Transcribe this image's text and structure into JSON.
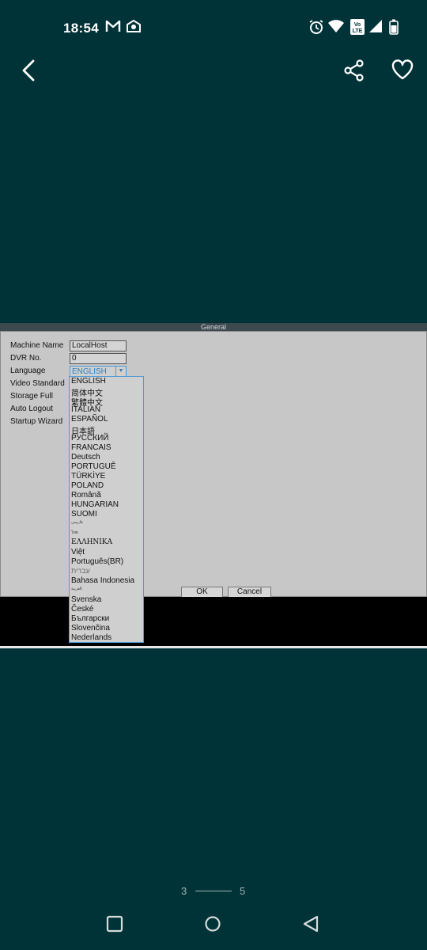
{
  "status_bar": {
    "time": "18:54",
    "icons": [
      "gmail-icon",
      "message-icon",
      "alarm-icon",
      "wifi-icon",
      "volte-icon",
      "signal-icon",
      "battery-icon"
    ],
    "volte_label": "Vo LTE"
  },
  "top_bar": {
    "back_icon": "back-arrow-icon",
    "share_icon": "share-icon",
    "favorite_icon": "heart-icon"
  },
  "dvr": {
    "title": "General",
    "labels": {
      "machine_name": "Machine Name",
      "dvr_no": "DVR No.",
      "language": "Language",
      "video_standard": "Video Standard",
      "storage_full": "Storage Full",
      "auto_logout": "Auto Logout",
      "startup_wizard": "Startup Wizard"
    },
    "values": {
      "machine_name": "LocalHost",
      "dvr_no": "0",
      "language": "ENGLISH"
    },
    "language_options": [
      "ENGLISH",
      "简体中文",
      "繁體中文",
      "ITALIAN",
      "ESPAÑOL",
      "日本語",
      "РУССКИЙ",
      "FRANCAIS",
      "Deutsch",
      "PORTUGUÊ",
      "TÜRKİYE",
      "POLAND",
      "Română",
      "HUNGARIAN",
      "SUOMI",
      "فارسی",
      "ไทย",
      "ΕΛΛΗΝΙΚΑ",
      "Việt",
      "Português(BR)",
      "עברית",
      "Bahasa Indonesia",
      "العربية",
      "Svenska",
      "České",
      "Български",
      "Slovenčina",
      "Nederlands"
    ],
    "ok_label": "OK",
    "cancel_label": "Cancel"
  },
  "pager": {
    "current": "3",
    "total": "5"
  }
}
